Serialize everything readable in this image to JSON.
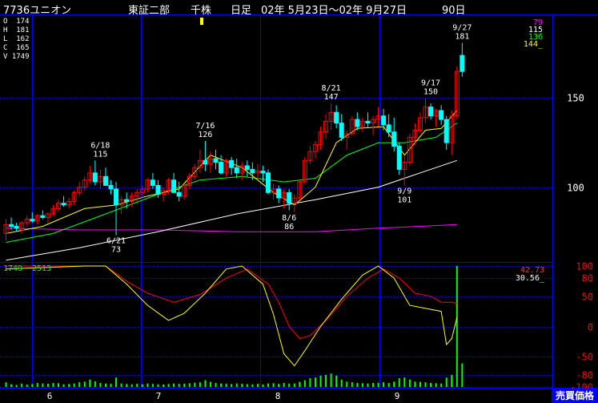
{
  "header": {
    "code_name": "7736ユニオン",
    "market": "東証二部",
    "unit": "千株",
    "period_type": "日足",
    "range": "02年 5月23日〜02年 9月27日",
    "days": "90日"
  },
  "ohlc": [
    {
      "key": "O",
      "value": "174"
    },
    {
      "key": "H",
      "value": "181"
    },
    {
      "key": "L",
      "value": "162"
    },
    {
      "key": "C",
      "value": "165"
    },
    {
      "key": "V",
      "value": "1749"
    }
  ],
  "ma_legend": [
    {
      "value": "79",
      "color": "#ff00ff"
    },
    {
      "value": "115",
      "color": "#ffffff"
    },
    {
      "value": "136",
      "color": "#00ff00"
    },
    {
      "value": "144_",
      "color": "#ffff00"
    }
  ],
  "osc_legend": [
    {
      "value": "42.73",
      "color": "#ff3333"
    },
    {
      "value": "30.56_",
      "color": "#ffffff"
    }
  ],
  "volume_legend": [
    {
      "value": "1749",
      "color": "#00ff00"
    },
    {
      "value": "2513",
      "color": "#00ff00"
    }
  ],
  "badge": "売買価格",
  "colors": {
    "grid": "#0000ff",
    "up_candle": "#ff0000",
    "down_candle": "#00ffff",
    "ma_short": "#ffff00",
    "ma_mid": "#00ff00",
    "ma_long": "#ffffff",
    "ma_longest": "#ff00ff",
    "osc_red": "#ff0000",
    "osc_yellow": "#ffff00",
    "volume": "#00ff00",
    "axis_text": "#ffffff"
  },
  "chart_data": [
    {
      "type": "candlestick",
      "title": "7736ユニオン 日足",
      "x_month_labels": [
        "6",
        "7",
        "8",
        "9"
      ],
      "y_ticks": [
        100,
        150
      ],
      "ylim": [
        58,
        197
      ],
      "annotations": [
        {
          "date": "6/18",
          "value": 115
        },
        {
          "date": "6/21",
          "value": 73
        },
        {
          "date": "7/16",
          "value": 126
        },
        {
          "date": "8/6",
          "value": 86
        },
        {
          "date": "8/21",
          "value": 147
        },
        {
          "date": "9/9",
          "value": 101
        },
        {
          "date": "9/17",
          "value": 150
        },
        {
          "date": "9/27",
          "value": 181
        }
      ],
      "candles": [
        [
          74,
          82,
          70,
          79
        ],
        [
          79,
          83,
          76,
          78
        ],
        [
          78,
          80,
          75,
          77
        ],
        [
          76,
          81,
          74,
          80
        ],
        [
          80,
          84,
          78,
          82
        ],
        [
          82,
          86,
          80,
          81
        ],
        [
          81,
          85,
          79,
          84
        ],
        [
          84,
          87,
          82,
          83
        ],
        [
          83,
          86,
          80,
          85
        ],
        [
          85,
          90,
          84,
          88
        ],
        [
          88,
          93,
          86,
          91
        ],
        [
          91,
          95,
          89,
          90
        ],
        [
          90,
          94,
          88,
          92
        ],
        [
          92,
          98,
          90,
          97
        ],
        [
          97,
          103,
          95,
          100
        ],
        [
          100,
          106,
          98,
          104
        ],
        [
          104,
          112,
          102,
          108
        ],
        [
          108,
          115,
          101,
          103
        ],
        [
          103,
          110,
          99,
          106
        ],
        [
          106,
          111,
          102,
          101
        ],
        [
          101,
          104,
          96,
          99
        ],
        [
          99,
          103,
          73,
          90
        ],
        [
          90,
          95,
          85,
          93
        ],
        [
          93,
          97,
          88,
          92
        ],
        [
          92,
          97,
          89,
          95
        ],
        [
          95,
          99,
          92,
          97
        ],
        [
          97,
          101,
          94,
          99
        ],
        [
          99,
          105,
          97,
          104
        ],
        [
          104,
          108,
          99,
          101
        ],
        [
          101,
          104,
          94,
          96
        ],
        [
          96,
          100,
          92,
          98
        ],
        [
          98,
          105,
          96,
          104
        ],
        [
          104,
          108,
          100,
          97
        ],
        [
          97,
          103,
          92,
          95
        ],
        [
          95,
          102,
          93,
          101
        ],
        [
          101,
          108,
          99,
          106
        ],
        [
          106,
          113,
          104,
          111
        ],
        [
          111,
          121,
          108,
          115
        ],
        [
          115,
          126,
          109,
          113
        ],
        [
          113,
          120,
          108,
          116
        ],
        [
          116,
          121,
          110,
          114
        ],
        [
          114,
          118,
          107,
          108
        ],
        [
          108,
          116,
          106,
          115
        ],
        [
          115,
          117,
          107,
          111
        ],
        [
          111,
          116,
          105,
          108
        ],
        [
          108,
          114,
          104,
          112
        ],
        [
          112,
          115,
          106,
          110
        ],
        [
          110,
          114,
          104,
          108
        ],
        [
          108,
          113,
          104,
          109
        ],
        [
          109,
          112,
          103,
          108
        ],
        [
          108,
          110,
          96,
          97
        ],
        [
          97,
          102,
          93,
          99
        ],
        [
          99,
          101,
          91,
          94
        ],
        [
          94,
          99,
          88,
          97
        ],
        [
          97,
          99,
          87,
          91
        ],
        [
          91,
          96,
          86,
          94
        ],
        [
          94,
          104,
          93,
          103
        ],
        [
          103,
          117,
          102,
          115
        ],
        [
          115,
          123,
          113,
          120
        ],
        [
          120,
          126,
          116,
          124
        ],
        [
          124,
          134,
          121,
          131
        ],
        [
          131,
          141,
          127,
          137
        ],
        [
          137,
          147,
          132,
          142
        ],
        [
          142,
          146,
          133,
          136
        ],
        [
          136,
          141,
          126,
          128
        ],
        [
          128,
          132,
          121,
          130
        ],
        [
          130,
          140,
          129,
          138
        ],
        [
          138,
          142,
          132,
          134
        ],
        [
          134,
          139,
          131,
          137
        ],
        [
          137,
          142,
          133,
          136
        ],
        [
          136,
          140,
          129,
          138
        ],
        [
          138,
          145,
          134,
          140
        ],
        [
          140,
          144,
          132,
          135
        ],
        [
          135,
          141,
          128,
          131
        ],
        [
          131,
          139,
          120,
          123
        ],
        [
          123,
          125,
          107,
          110
        ],
        [
          110,
          118,
          101,
          114
        ],
        [
          114,
          130,
          112,
          128
        ],
        [
          128,
          136,
          124,
          132
        ],
        [
          132,
          142,
          130,
          139
        ],
        [
          139,
          150,
          136,
          145
        ],
        [
          145,
          147,
          138,
          140
        ],
        [
          140,
          144,
          134,
          143
        ],
        [
          143,
          146,
          135,
          138
        ],
        [
          138,
          140,
          121,
          125
        ],
        [
          125,
          143,
          118,
          140
        ],
        [
          140,
          168,
          138,
          165
        ],
        [
          174,
          181,
          162,
          165
        ]
      ],
      "ma_short_pts": [
        [
          1,
          74
        ],
        [
          8,
          78
        ],
        [
          16,
          88
        ],
        [
          22,
          90
        ],
        [
          28,
          95
        ],
        [
          34,
          99
        ],
        [
          40,
          118
        ],
        [
          46,
          111
        ],
        [
          52,
          97
        ],
        [
          56,
          90
        ],
        [
          60,
          100
        ],
        [
          64,
          125
        ],
        [
          68,
          133
        ],
        [
          73,
          134
        ],
        [
          77,
          118
        ],
        [
          81,
          132
        ],
        [
          84,
          133
        ],
        [
          87,
          143
        ]
      ],
      "ma_mid_pts": [
        [
          1,
          69
        ],
        [
          10,
          74
        ],
        [
          20,
          85
        ],
        [
          30,
          96
        ],
        [
          38,
          104
        ],
        [
          46,
          106
        ],
        [
          54,
          103
        ],
        [
          60,
          105
        ],
        [
          66,
          118
        ],
        [
          72,
          125
        ],
        [
          77,
          125
        ],
        [
          83,
          128
        ],
        [
          87,
          136
        ]
      ],
      "ma_long_pts": [
        [
          1,
          59
        ],
        [
          15,
          66
        ],
        [
          30,
          75
        ],
        [
          45,
          85
        ],
        [
          60,
          93
        ],
        [
          72,
          100
        ],
        [
          80,
          108
        ],
        [
          87,
          115
        ]
      ],
      "ma_longest_pts": [
        [
          1,
          77
        ],
        [
          15,
          76
        ],
        [
          30,
          76
        ],
        [
          45,
          75
        ],
        [
          60,
          75
        ],
        [
          72,
          77
        ],
        [
          80,
          78
        ],
        [
          87,
          79
        ]
      ]
    },
    {
      "type": "line",
      "title": "oscillator",
      "y_ticks": [
        100,
        80,
        50,
        0,
        -50,
        -80,
        -100
      ],
      "ylim": [
        -100,
        100
      ],
      "series": [
        {
          "color": "red",
          "points": [
            [
              1,
              100
            ],
            [
              16,
              100
            ],
            [
              20,
              100
            ],
            [
              24,
              75
            ],
            [
              28,
              55
            ],
            [
              33,
              40
            ],
            [
              38,
              53
            ],
            [
              43,
              80
            ],
            [
              47,
              95
            ],
            [
              51,
              70
            ],
            [
              53,
              40
            ],
            [
              55,
              0
            ],
            [
              57,
              -20
            ],
            [
              59,
              -15
            ],
            [
              62,
              10
            ],
            [
              66,
              50
            ],
            [
              70,
              80
            ],
            [
              73,
              95
            ],
            [
              76,
              80
            ],
            [
              79,
              55
            ],
            [
              82,
              50
            ],
            [
              84,
              40
            ],
            [
              86,
              40
            ],
            [
              87,
              38
            ]
          ]
        },
        {
          "color": "yellow",
          "points": [
            [
              1,
              95
            ],
            [
              16,
              100
            ],
            [
              20,
              100
            ],
            [
              24,
              70
            ],
            [
              28,
              35
            ],
            [
              32,
              10
            ],
            [
              35,
              22
            ],
            [
              39,
              55
            ],
            [
              43,
              95
            ],
            [
              46,
              100
            ],
            [
              50,
              70
            ],
            [
              52,
              20
            ],
            [
              54,
              -45
            ],
            [
              56,
              -65
            ],
            [
              58,
              -40
            ],
            [
              61,
              0
            ],
            [
              65,
              45
            ],
            [
              69,
              85
            ],
            [
              72,
              100
            ],
            [
              75,
              80
            ],
            [
              78,
              35
            ],
            [
              81,
              30
            ],
            [
              84,
              25
            ],
            [
              85,
              -30
            ],
            [
              86,
              -20
            ],
            [
              87,
              15
            ]
          ]
        }
      ]
    },
    {
      "type": "bar",
      "title": "volume",
      "values": [
        350,
        200,
        150,
        250,
        180,
        220,
        300,
        260,
        240,
        300,
        280,
        200,
        220,
        260,
        350,
        400,
        550,
        420,
        300,
        250,
        230,
        700,
        260,
        220,
        200,
        240,
        210,
        260,
        230,
        200,
        180,
        220,
        260,
        230,
        240,
        280,
        320,
        350,
        500,
        380,
        300,
        260,
        240,
        220,
        260,
        230,
        210,
        200,
        230,
        190,
        260,
        280,
        230,
        300,
        250,
        260,
        380,
        500,
        650,
        700,
        850,
        900,
        1000,
        850,
        550,
        400,
        350,
        300,
        280,
        260,
        300,
        320,
        350,
        300,
        400,
        650,
        700,
        550,
        400,
        380,
        350,
        300,
        280,
        260,
        700,
        900,
        9000,
        1749
      ]
    }
  ]
}
